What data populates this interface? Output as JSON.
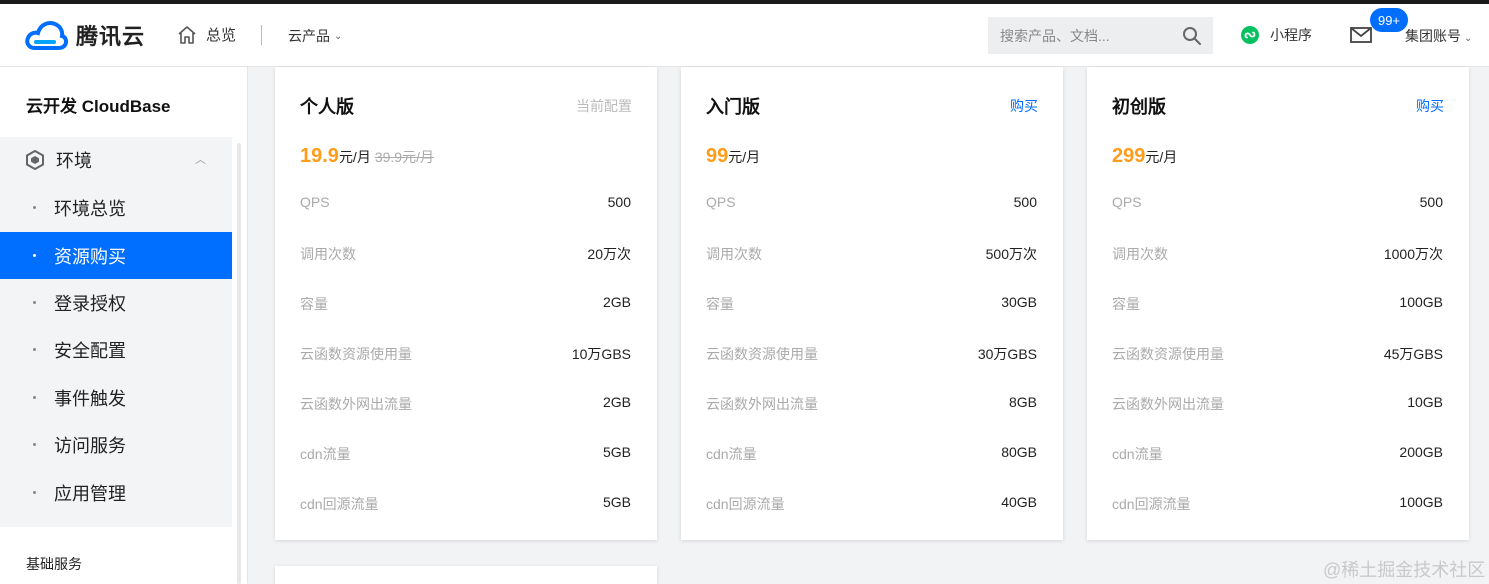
{
  "header": {
    "logo_text": "腾讯云",
    "overview": "总览",
    "products": "云产品",
    "search_placeholder": "搜索产品、文档...",
    "mini_program": "小程序",
    "message_badge": "99+",
    "account": "集团账号"
  },
  "sidebar": {
    "title": "云开发 CloudBase",
    "group_label": "环境",
    "items": [
      {
        "label": "环境总览"
      },
      {
        "label": "资源购买"
      },
      {
        "label": "登录授权"
      },
      {
        "label": "安全配置"
      },
      {
        "label": "事件触发"
      },
      {
        "label": "访问服务"
      },
      {
        "label": "应用管理"
      }
    ],
    "active_index": 1,
    "section_label": "基础服务"
  },
  "spec_labels": [
    "QPS",
    "调用次数",
    "容量",
    "云函数资源使用量",
    "云函数外网出流量",
    "cdn流量",
    "cdn回源流量"
  ],
  "plans": [
    {
      "name": "个人版",
      "action": "当前配置",
      "price": "19.9",
      "unit": "元/月",
      "old_price": "39.9元/月",
      "specs": [
        "500",
        "20万次",
        "2GB",
        "10万GBS",
        "2GB",
        "5GB",
        "5GB"
      ]
    },
    {
      "name": "入门版",
      "action": "购买",
      "price": "99",
      "unit": "元/月",
      "old_price": "",
      "specs": [
        "500",
        "500万次",
        "30GB",
        "30万GBS",
        "8GB",
        "80GB",
        "40GB"
      ]
    },
    {
      "name": "初创版",
      "action": "购买",
      "price": "299",
      "unit": "元/月",
      "old_price": "",
      "specs": [
        "500",
        "1000万次",
        "100GB",
        "45万GBS",
        "10GB",
        "200GB",
        "100GB"
      ]
    }
  ],
  "watermark": "@稀土掘金技术社区",
  "colors": {
    "accent": "#006eff",
    "price": "#ff9c19"
  }
}
